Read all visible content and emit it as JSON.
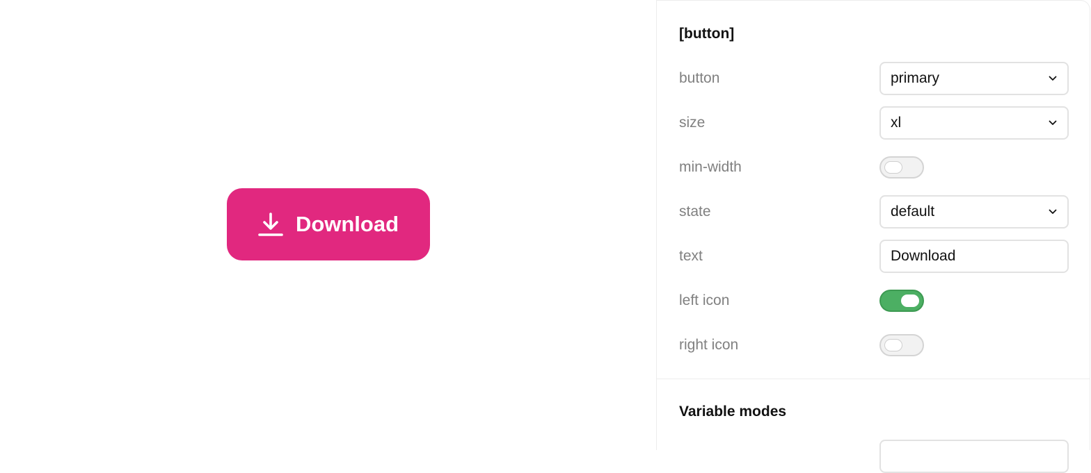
{
  "preview": {
    "button_label": "Download",
    "button_color": "#e1287f",
    "icon": "download-icon"
  },
  "panel": {
    "title": "[button]",
    "rows": {
      "button": {
        "label": "button",
        "value": "primary"
      },
      "size": {
        "label": "size",
        "value": "xl"
      },
      "min_width": {
        "label": "min-width",
        "checked": false
      },
      "state": {
        "label": "state",
        "value": "default"
      },
      "text": {
        "label": "text",
        "value": "Download"
      },
      "left_icon": {
        "label": "left icon",
        "checked": true
      },
      "right_icon": {
        "label": "right icon",
        "checked": false
      }
    },
    "toggle_on_color": "#4caf63",
    "variable_modes_title": "Variable modes"
  }
}
